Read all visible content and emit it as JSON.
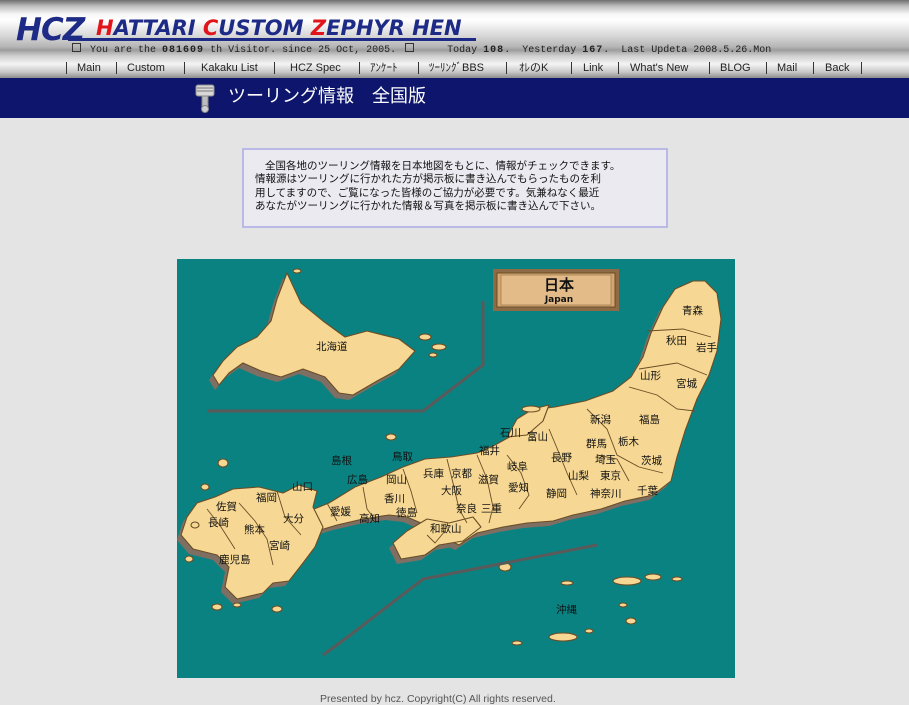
{
  "header": {
    "logo": {
      "abbr": "HCZ",
      "title_parts": [
        "H",
        "ATTARI ",
        "C",
        "USTOM ",
        "Z",
        "EPHYR HEN"
      ]
    },
    "counter": {
      "prefix": "You are the",
      "visitor_number": "081609",
      "suffix": "th Visitor. since 25 Oct, 2005.",
      "today_label": "Today",
      "today_value": "108",
      "yesterday_label": "Yesterday",
      "yesterday_value": "167",
      "last_update": "Last Updeta 2008.5.26.Mon"
    },
    "nav": [
      "Main",
      "Custom",
      "Kakaku List",
      "HCZ Spec",
      "ｱﾝｹｰﾄ",
      "ﾂｰﾘﾝｸﾞBBS",
      "ｵﾚのK",
      "Link",
      "What's New",
      "BLOG",
      "Mail",
      "Back"
    ]
  },
  "banner": {
    "title": "ツーリング情報　全国版",
    "icon": "piston-icon"
  },
  "intro": {
    "lines": [
      "全国各地のツーリング情報を日本地図をもとに、情報がチェックできます。",
      "情報源はツーリングに行かれた方が掲示板に書き込んでもらったものを利",
      "用してますので、ご覧になった皆様のご協力が必要です。気兼ねなく最近",
      "あなたがツーリングに行かれた情報＆写真を掲示板に書き込んで下さい。"
    ]
  },
  "map": {
    "sign_title": "日本",
    "sign_subtitle": "Japan",
    "colors": {
      "sea": "#0a8282",
      "land": "#f6d894",
      "border": "#6a4d25",
      "sign": "#d4a56e"
    },
    "prefectures": [
      "北海道",
      "青森",
      "秋田",
      "岩手",
      "山形",
      "宮城",
      "新潟",
      "福島",
      "石川",
      "富山",
      "群馬",
      "栃木",
      "福井",
      "長野",
      "埼玉",
      "茨城",
      "岐阜",
      "山梨",
      "東京",
      "島根",
      "鳥取",
      "兵庫",
      "京都",
      "滋賀",
      "広島",
      "岡山",
      "大阪",
      "愛知",
      "静岡",
      "神奈川",
      "千葉",
      "山口",
      "福岡",
      "香川",
      "奈良",
      "三重",
      "佐賀",
      "大分",
      "愛媛",
      "高知",
      "徳島",
      "長崎",
      "熊本",
      "和歌山",
      "宮崎",
      "鹿児島",
      "沖縄"
    ]
  },
  "footer": {
    "text": "Presented by hcz. Copyright(C) All rights reserved."
  }
}
